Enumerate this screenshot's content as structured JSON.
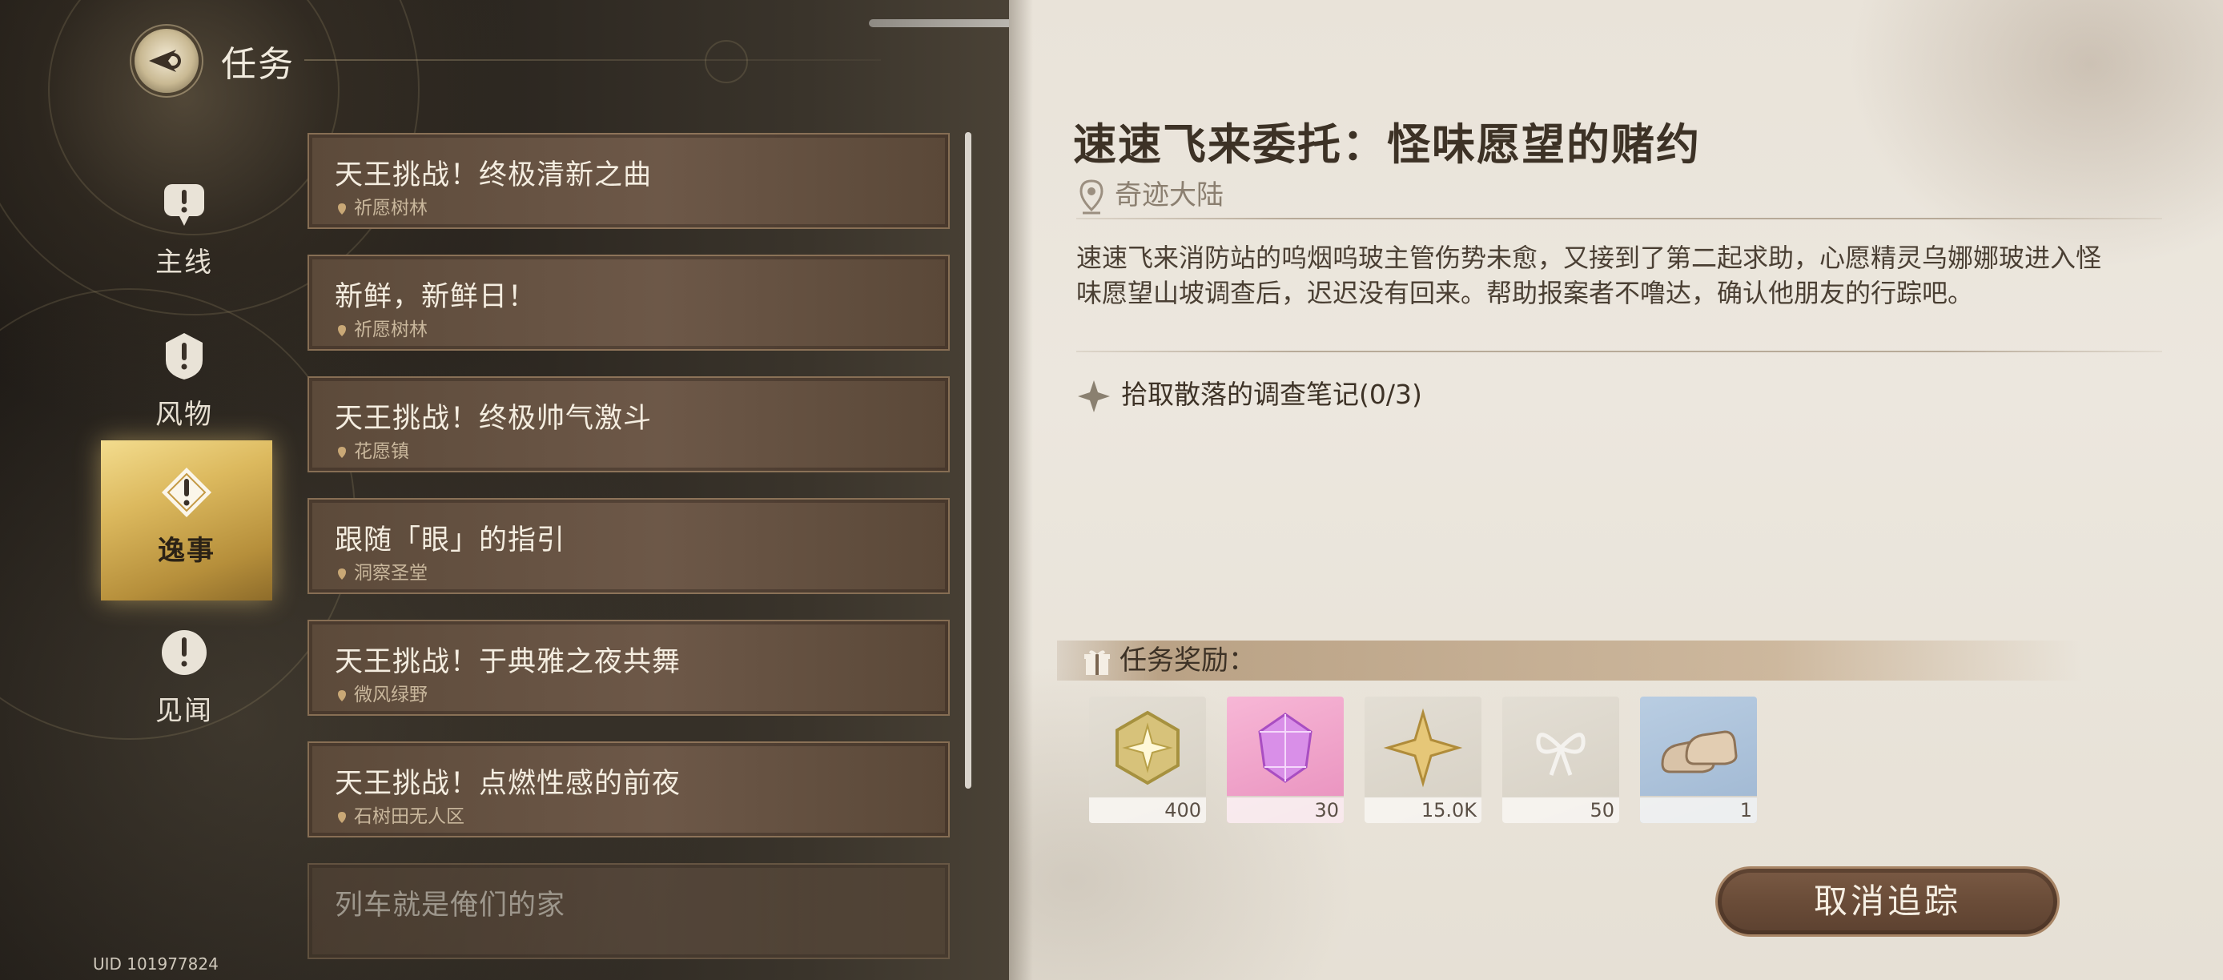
{
  "header": {
    "title": "任务",
    "icon": "quest-compass-icon"
  },
  "categories": [
    {
      "label": "主线",
      "icon": "exclamation-bubble-icon",
      "active": false
    },
    {
      "label": "风物",
      "icon": "exclamation-shield-icon",
      "active": false
    },
    {
      "label": "逸事",
      "icon": "exclamation-diamond-icon",
      "active": true
    },
    {
      "label": "见闻",
      "icon": "exclamation-circle-icon",
      "active": false
    }
  ],
  "quests": [
    {
      "title": "天王挑战！终极清新之曲",
      "location": "祈愿树林"
    },
    {
      "title": "新鲜，新鲜日！",
      "location": "祈愿树林"
    },
    {
      "title": "天王挑战！终极帅气激斗",
      "location": "花愿镇"
    },
    {
      "title": "跟随「眼」的指引",
      "location": "洞察圣堂"
    },
    {
      "title": "天王挑战！于典雅之夜共舞",
      "location": "微风绿野"
    },
    {
      "title": "天王挑战！点燃性感的前夜",
      "location": "石树田无人区"
    },
    {
      "title": "列车就是俺们的家",
      "location": ""
    }
  ],
  "uid": "UID 101977824",
  "detail": {
    "title": "速速飞来委托：怪味愿望的赌约",
    "location": "奇迹大陆",
    "description": "速速飞来消防站的呜烟呜玻主管伤势未愈，又接到了第二起求助，心愿精灵乌娜娜玻进入怪味愿望山坡调查后，迟迟没有回来。帮助报案者不噜达，确认他朋友的行踪吧。",
    "objective": "拾取散落的调查笔记(0/3)",
    "reward_label": "任务奖励：",
    "rewards": [
      {
        "icon": "gold-star-badge-icon",
        "qty": "400"
      },
      {
        "icon": "pink-crystal-icon",
        "qty": "30"
      },
      {
        "icon": "gold-four-point-star-icon",
        "qty": "15.0K"
      },
      {
        "icon": "white-ribbon-bow-icon",
        "qty": "50"
      },
      {
        "icon": "beige-shoes-icon",
        "qty": "1"
      }
    ],
    "untrack_button": "取消追踪"
  },
  "colors": {
    "active_tab_gold": "#dcb95e",
    "quest_item_bg": "#6d5848",
    "parchment": "#ece7de",
    "button_brown": "#6a4c38"
  }
}
